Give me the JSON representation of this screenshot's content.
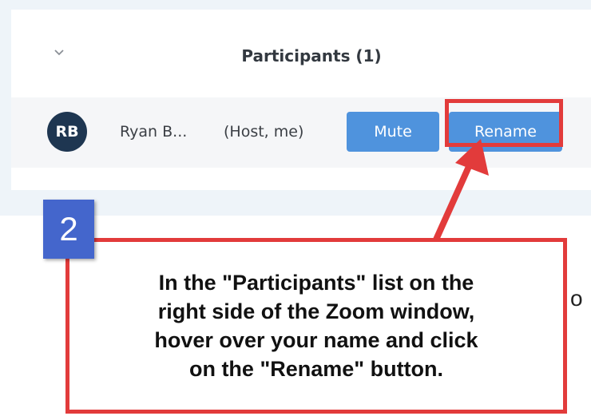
{
  "panel": {
    "title": "Participants (1)"
  },
  "participant": {
    "initials": "RB",
    "name": "Ryan B...",
    "role": "(Host, me)",
    "avatar_color": "#1e3651"
  },
  "actions": {
    "mute_label": "Mute",
    "rename_label": "Rename",
    "button_color": "#4f93dd"
  },
  "callout": {
    "step_number": "2",
    "text": "In the \"Participants\" list on the\nright side of the Zoom window,\nhover over your name and click\non the \"Rename\" button.",
    "highlight_color": "#e23b3b",
    "badge_color": "#4466cc"
  },
  "edge_char": "o",
  "icons": {
    "collapse": "chevron-down-icon"
  }
}
